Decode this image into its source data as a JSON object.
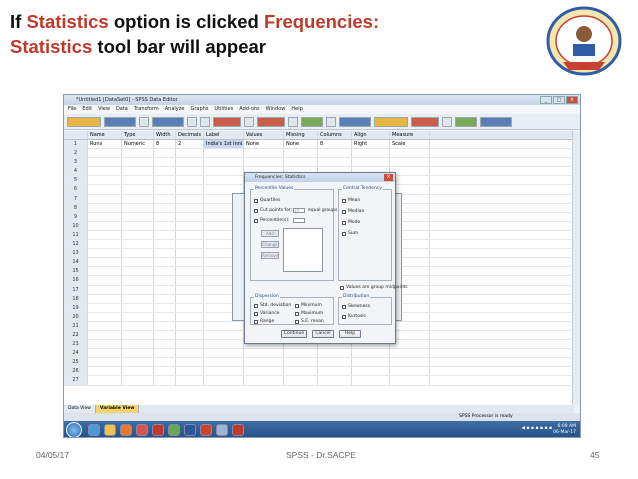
{
  "slide": {
    "title_part1": "If ",
    "title_red1": "Statistics",
    "title_part2": " option is clicked ",
    "title_red2": "Frequencies:",
    "title_line2_red": "Statistics",
    "title_line2_rest": " tool bar will appear",
    "footer_date": "04/05/17",
    "footer_center": "SPSS - Dr.SACPE",
    "footer_page": "45"
  },
  "window": {
    "title": "*Untitled1 [DataSet0] - SPSS Data Editor",
    "menu": [
      "File",
      "Edit",
      "View",
      "Data",
      "Transform",
      "Analyze",
      "Graphs",
      "Utilities",
      "Add-ons",
      "Window",
      "Help"
    ]
  },
  "grid": {
    "columns": [
      "",
      "Name",
      "Type",
      "Width",
      "Decimals",
      "Label",
      "Values",
      "Missing",
      "Columns",
      "Align",
      "Measure"
    ],
    "row1": [
      "1",
      "Runs",
      "Numeric",
      "8",
      "2",
      "India's 1st inni...",
      "None",
      "None",
      "8",
      "Right",
      "Scale"
    ],
    "row_numbers": [
      "2",
      "3",
      "4",
      "5",
      "6",
      "7",
      "8",
      "9",
      "10",
      "11",
      "12",
      "13",
      "14",
      "15",
      "16",
      "17",
      "18",
      "19",
      "20",
      "21",
      "22",
      "23",
      "24",
      "25",
      "26",
      "27"
    ]
  },
  "tabs": {
    "data_view": "Data View",
    "variable_view": "Variable View"
  },
  "status": {
    "text": "SPSS Processor is ready"
  },
  "taskbar": {
    "time": "6:09 AM",
    "date": "06-Mar-17"
  },
  "dialog": {
    "title": "Frequencies: Statistics",
    "percentile_group": "Percentile Values",
    "quartiles": "Quartiles",
    "cut_points": "Cut points for:",
    "cut_points_value": "10",
    "equal_groups": "equal groups",
    "percentiles": "Percentile(s):",
    "add": "Add",
    "change": "Change",
    "remove": "Remove",
    "central_group": "Central Tendency",
    "mean": "Mean",
    "median": "Median",
    "mode": "Mode",
    "sum": "Sum",
    "group_midpoints": "Values are group midpoints",
    "dispersion_group": "Dispersion",
    "std_dev": "Std. deviation",
    "minimum": "Minimum",
    "variance": "Variance",
    "maximum": "Maximum",
    "range": "Range",
    "se_mean": "S.E. mean",
    "distribution_group": "Distribution",
    "skewness": "Skewness",
    "kurtosis": "Kurtosis",
    "continue": "Continue",
    "cancel": "Cancel",
    "help": "Help"
  },
  "colors": {
    "accent_red": "#c0392b",
    "taskbar_blue": "#2d5c96",
    "variable_tab": "#f3d56b"
  }
}
